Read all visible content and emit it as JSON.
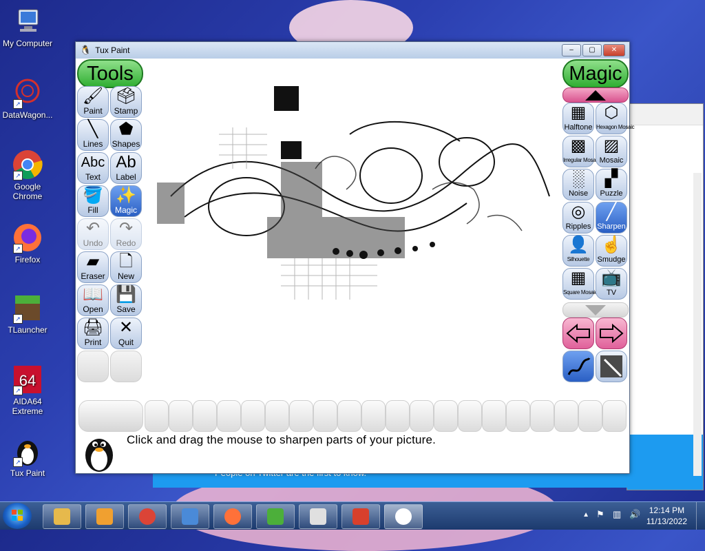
{
  "desktop": {
    "icons": [
      {
        "label": "My Computer",
        "icon": "computer-icon"
      },
      {
        "label": "DataWagon...",
        "icon": "network-icon"
      },
      {
        "label": "Google Chrome",
        "icon": "chrome-icon"
      },
      {
        "label": "Firefox",
        "icon": "firefox-icon"
      },
      {
        "label": "TLauncher",
        "icon": "minecraft-icon"
      },
      {
        "label": "AIDA64 Extreme",
        "icon": "aida64-icon"
      },
      {
        "label": "Tux Paint",
        "icon": "tux-icon"
      }
    ],
    "background_window_text": "People on Twitter are the first to know."
  },
  "window": {
    "title": "Tux Paint",
    "controls": {
      "minimize": "–",
      "maximize": "▢",
      "close": "✕"
    }
  },
  "tools_panel": {
    "header": "Tools",
    "tools": [
      {
        "label": "Paint",
        "glyph": "🖌"
      },
      {
        "label": "Stamp",
        "glyph": "🗳"
      },
      {
        "label": "Lines",
        "glyph": "╲"
      },
      {
        "label": "Shapes",
        "glyph": "⬟"
      },
      {
        "label": "Text",
        "glyph": "Abc"
      },
      {
        "label": "Label",
        "glyph": "Ab"
      },
      {
        "label": "Fill",
        "glyph": "🪣"
      },
      {
        "label": "Magic",
        "glyph": "✨"
      },
      {
        "label": "Undo",
        "glyph": "↶"
      },
      {
        "label": "Redo",
        "glyph": "↷"
      },
      {
        "label": "Eraser",
        "glyph": "▰"
      },
      {
        "label": "New",
        "glyph": "🗋"
      },
      {
        "label": "Open",
        "glyph": "📖"
      },
      {
        "label": "Save",
        "glyph": "💾"
      },
      {
        "label": "Print",
        "glyph": "🖨"
      },
      {
        "label": "Quit",
        "glyph": "✕"
      }
    ],
    "active_tool": "Magic"
  },
  "magic_panel": {
    "header": "Magic",
    "items": [
      {
        "label": "Halftone",
        "glyph": "▦"
      },
      {
        "label": "Hexagon Mosaic",
        "glyph": "⬡"
      },
      {
        "label": "Irregular Mosaic",
        "glyph": "▩"
      },
      {
        "label": "Mosaic",
        "glyph": "▨"
      },
      {
        "label": "Noise",
        "glyph": "░"
      },
      {
        "label": "Puzzle",
        "glyph": "▞"
      },
      {
        "label": "Ripples",
        "glyph": "◎"
      },
      {
        "label": "Sharpen",
        "glyph": "╱"
      },
      {
        "label": "Silhouette",
        "glyph": "👤"
      },
      {
        "label": "Smudge",
        "glyph": "☝"
      },
      {
        "label": "Square Mosaic",
        "glyph": "▦"
      },
      {
        "label": "TV",
        "glyph": "📺"
      }
    ],
    "active_item": "Sharpen"
  },
  "instruction": "Click and drag the mouse to sharpen parts of your picture.",
  "taskbar": {
    "time": "12:14 PM",
    "date": "11/13/2022",
    "apps": [
      "explorer-icon",
      "media-player-icon",
      "chrome-icon",
      "control-panel-icon",
      "firefox-icon",
      "minecraft-icon",
      "java-icon",
      "rocket-icon",
      "tux-icon"
    ]
  }
}
